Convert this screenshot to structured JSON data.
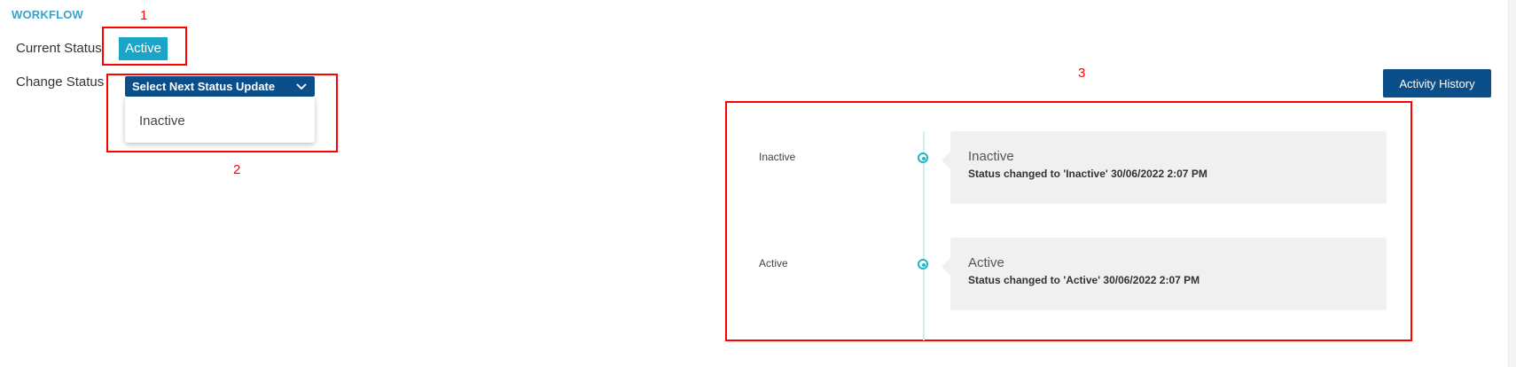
{
  "workflow": {
    "section_title": "WORKFLOW",
    "current_status_label": "Current Status",
    "current_status_value": "Active",
    "change_status_label": "Change Status",
    "dropdown": {
      "label": "Select Next Status Update",
      "options": [
        "Inactive"
      ]
    }
  },
  "annotations": {
    "n1": "1",
    "n2": "2",
    "n3": "3",
    "color": "#ff0000"
  },
  "activity": {
    "button_label": "Activity History",
    "entries": [
      {
        "label": "Inactive",
        "title": "Inactive",
        "description": "Status changed to 'Inactive' 30/06/2022 2:07 PM"
      },
      {
        "label": "Active",
        "title": "Active",
        "description": "Status changed to 'Active' 30/06/2022 2:07 PM"
      }
    ]
  },
  "colors": {
    "accent": "#1aa5c7",
    "primary_button": "#0b4f8a",
    "section_title": "#3aa3c9",
    "timeline_dot": "#1bb9c8"
  },
  "icons": {
    "dropdown": "chevron-down-icon",
    "timeline": "circle-dot-icon"
  }
}
